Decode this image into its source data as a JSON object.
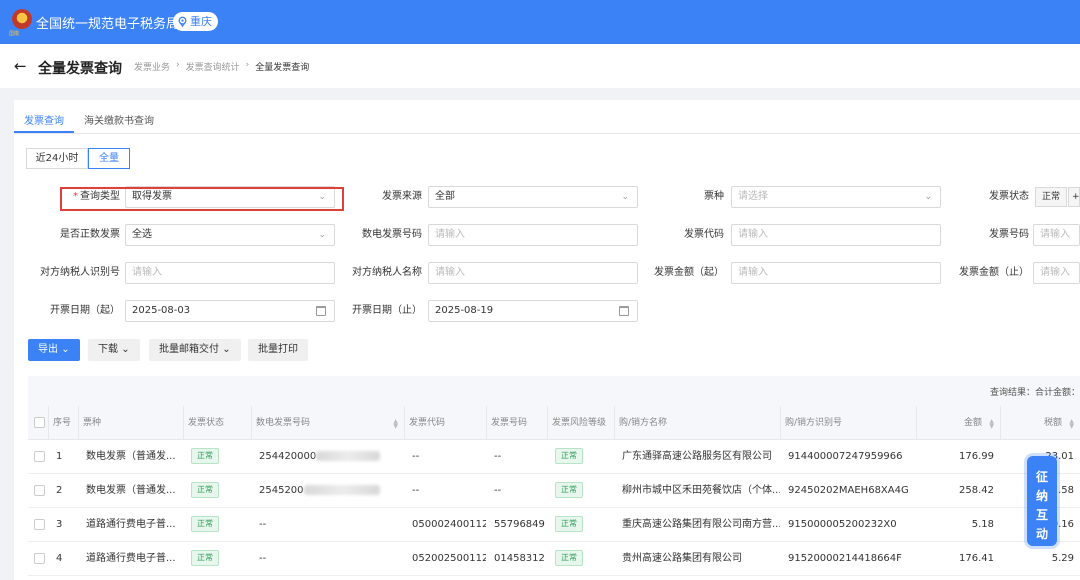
{
  "header": {
    "emblem_text": "国徽",
    "site_title": "全国统一规范电子税务局",
    "region": "重庆"
  },
  "titlebar": {
    "back": "←",
    "title": "全量发票查询",
    "breadcrumbs": [
      "发票业务",
      "发票查询统计",
      "全量发票查询"
    ],
    "separator": "›"
  },
  "tabs": [
    {
      "label": "发票查询",
      "active": true
    },
    {
      "label": "海关缴款书查询",
      "active": false
    }
  ],
  "time_range": {
    "options": [
      "近24小时",
      "全量"
    ],
    "selected": "全量"
  },
  "form": {
    "query_type": {
      "label": "查询类型",
      "value": "取得发票"
    },
    "invoice_source": {
      "label": "发票来源",
      "value": "全部"
    },
    "invoice_kind": {
      "label": "票种",
      "placeholder": "请选择"
    },
    "invoice_status": {
      "label": "发票状态",
      "value": "正常",
      "more": "+"
    },
    "is_positive": {
      "label": "是否正数发票",
      "value": "全选"
    },
    "digital_no": {
      "label": "数电发票号码",
      "placeholder": "请输入"
    },
    "invoice_code": {
      "label": "发票代码",
      "placeholder": "请输入"
    },
    "invoice_no": {
      "label": "发票号码",
      "placeholder": "请输入"
    },
    "counterparty_id": {
      "label": "对方纳税人识别号",
      "placeholder": "请输入"
    },
    "counterparty_name": {
      "label": "对方纳税人名称",
      "placeholder": "请输入"
    },
    "amount_from": {
      "label": "发票金额（起）",
      "placeholder": "请输入"
    },
    "amount_to": {
      "label": "发票金额（止）",
      "placeholder": "请输入"
    },
    "date_from": {
      "label": "开票日期（起）",
      "value": "2025-08-03"
    },
    "date_to": {
      "label": "开票日期（止）",
      "value": "2025-08-19"
    }
  },
  "actions": {
    "export": "导出",
    "download": "下载",
    "batch_mail": "批量邮箱交付",
    "batch_print": "批量打印"
  },
  "result_summary": "查询结果：合计金额：",
  "table": {
    "columns": [
      "序号",
      "票种",
      "发票状态",
      "数电发票号码",
      "发票代码",
      "发票号码",
      "发票风险等级",
      "购/销方名称",
      "购/销方识别号",
      "金额",
      "税额"
    ],
    "rows": [
      {
        "idx": "1",
        "kind": "数电发票（普通发...",
        "status": "正常",
        "digital_no": "254420000",
        "code": "--",
        "number": "--",
        "risk": "正常",
        "party": "广东通驿高速公路服务区有限公司",
        "party_id": "914400007247959966",
        "amount": "176.99",
        "tax": "23.01"
      },
      {
        "idx": "2",
        "kind": "数电发票（普通发...",
        "status": "正常",
        "digital_no": "2545200",
        "code": "--",
        "number": "--",
        "risk": "正常",
        "party": "柳州市城中区禾田苑餐饮店（个体...",
        "party_id": "92450202MAEH68XA4G",
        "amount": "258.42",
        "tax": "2.58"
      },
      {
        "idx": "3",
        "kind": "道路通行费电子普...",
        "status": "正常",
        "digital_no": "--",
        "code": "050002400112",
        "number": "55796849",
        "risk": "正常",
        "party": "重庆高速公路集团有限公司南方营...",
        "party_id": "915000005200232X0",
        "amount": "5.18",
        "tax": "0.16"
      },
      {
        "idx": "4",
        "kind": "道路通行费电子普...",
        "status": "正常",
        "digital_no": "--",
        "code": "052002500112",
        "number": "01458312",
        "risk": "正常",
        "party": "贵州高速公路集团有限公司",
        "party_id": "91520000214418664F",
        "amount": "176.41",
        "tax": "5.29"
      }
    ]
  },
  "float_widget": [
    "征",
    "纳",
    "互",
    "动"
  ],
  "colors": {
    "primary": "#3b82f6",
    "highlight": "#e0403a",
    "status_green": "#2e9b57"
  }
}
